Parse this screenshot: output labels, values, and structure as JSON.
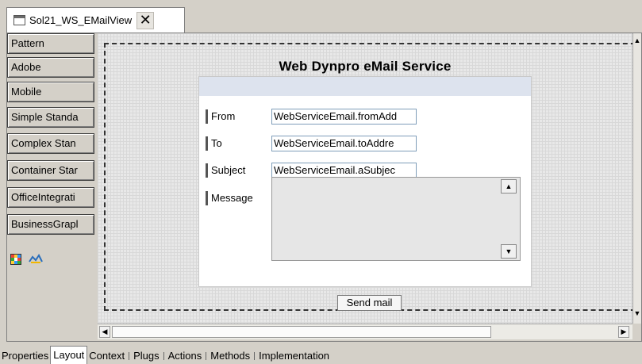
{
  "editor_tab": {
    "title": "Sol21_WS_EMailView",
    "close_icon": "close-icon"
  },
  "palette": {
    "items": [
      {
        "label": "Pattern"
      },
      {
        "label": "Adobe"
      },
      {
        "label": "Mobile"
      },
      {
        "label": "Simple Standa"
      },
      {
        "label": "Complex Stan"
      },
      {
        "label": "Container Star"
      },
      {
        "label": "OfficeIntegrati"
      },
      {
        "label": "BusinessGrapl"
      }
    ],
    "icons": [
      "layout-grid-icon",
      "cloud-icon"
    ]
  },
  "view": {
    "title": "Web Dynpro eMail Service",
    "fields": [
      {
        "label": "From",
        "value": "WebServiceEmail.fromAdd"
      },
      {
        "label": "To",
        "value": "WebServiceEmail.toAddre"
      },
      {
        "label": "Subject",
        "value": "WebServiceEmail.aSubjec"
      }
    ],
    "message_label": "Message",
    "send_button": "Send mail"
  },
  "bottom_tabs": {
    "items": [
      {
        "label": "Properties"
      },
      {
        "label": "Layout",
        "active": true
      },
      {
        "label": "Context"
      },
      {
        "label": "Plugs"
      },
      {
        "label": "Actions"
      },
      {
        "label": "Methods"
      },
      {
        "label": "Implementation"
      }
    ]
  },
  "colors": {
    "chrome": "#d4d0c8",
    "canvas": "#e8e8e8",
    "form_header": "#dde3ee",
    "input_border": "#7f9db9"
  }
}
